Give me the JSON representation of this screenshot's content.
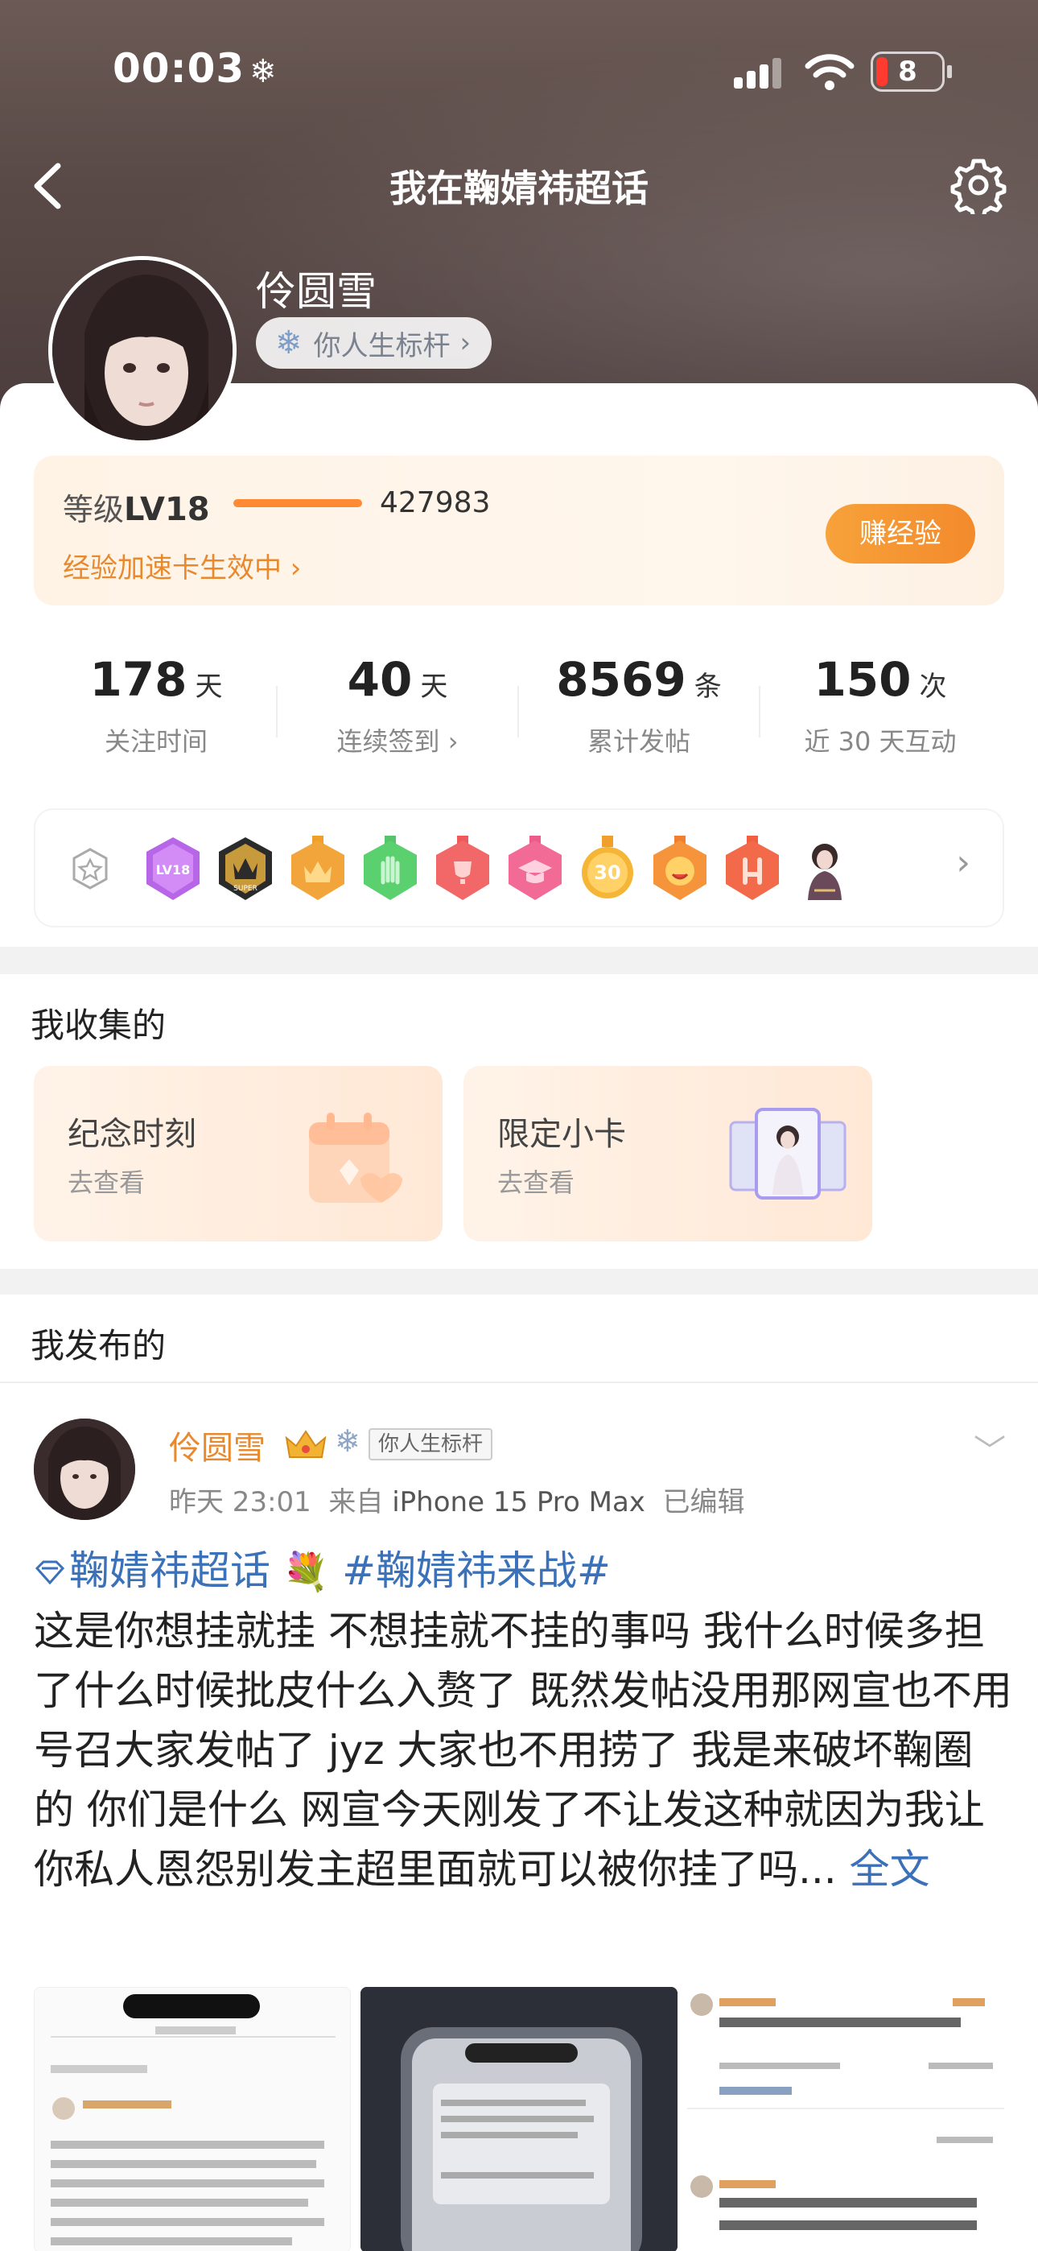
{
  "status": {
    "time": "00:03",
    "battery": "8"
  },
  "nav": {
    "title": "我在鞠婧祎超话"
  },
  "profile": {
    "name": "伶圆雪",
    "title_chip": "你人生标杆"
  },
  "level": {
    "label": "等级",
    "level": "LV18",
    "exp": "427983",
    "boost": "经验加速卡生效中",
    "earn_button": "赚经验"
  },
  "stats": [
    {
      "value": "178",
      "unit": "天",
      "label": "关注时间"
    },
    {
      "value": "40",
      "unit": "天",
      "label": "连续签到"
    },
    {
      "value": "8569",
      "unit": "条",
      "label": "累计发帖"
    },
    {
      "value": "150",
      "unit": "次",
      "label": "近 30 天互动"
    }
  ],
  "badges": {
    "icons": [
      "lv18-badge",
      "super-badge",
      "crown-badge",
      "hand-badge",
      "trophy-badge",
      "graduate-badge",
      "30-days-badge",
      "emoji-badge",
      "rock-hand-badge",
      "figure-badge"
    ]
  },
  "collections": {
    "title": "我收集的",
    "items": [
      {
        "title": "纪念时刻",
        "subtitle": "去查看"
      },
      {
        "title": "限定小卡",
        "subtitle": "去查看"
      }
    ]
  },
  "posts": {
    "title": "我发布的",
    "post": {
      "author": "伶圆雪",
      "author_title": "你人生标杆",
      "time": "昨天 23:01",
      "source_prefix": "来自",
      "device": "iPhone 15 Pro Max",
      "edited": "已编辑",
      "supertopic": "鞠婧祎超话",
      "hashtag": "#鞠婧祎来战#",
      "body": "这是你想挂就挂 不想挂就不挂的事吗 我什么时候多担了什么时候批皮什么入赘了 既然发帖没用那网宣也不用号召大家发帖了 jyz 大家也不用捞了 我是来破坏鞠圈的 你们是什么 网宣今天刚发了不让发这种就因为我让你私人恩怨别发主超里面就可以被你挂了吗...",
      "full_text": "全文"
    }
  }
}
